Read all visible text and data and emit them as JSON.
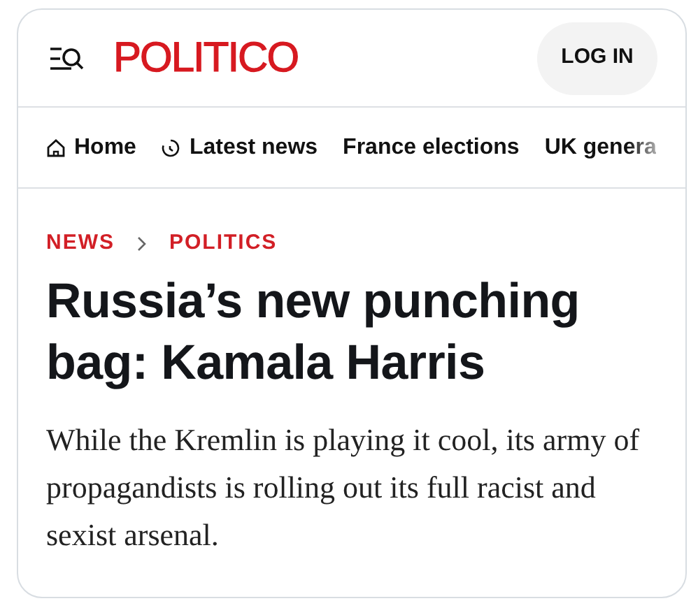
{
  "header": {
    "logo": "POLITICO",
    "login_button": "LOG IN"
  },
  "nav": [
    {
      "label": "Home",
      "kind": "home"
    },
    {
      "label": "Latest news",
      "kind": "latest"
    },
    {
      "label": "France elections",
      "kind": "plain"
    },
    {
      "label": "UK genera",
      "kind": "faded"
    }
  ],
  "breadcrumb": [
    "NEWS",
    "POLITICS"
  ],
  "headline": "Russia’s new punching bag: Kamala Harris",
  "summary": "While the Kremlin is playing it cool, its army of propagandists is rolling out its full racist and sexist arsenal."
}
